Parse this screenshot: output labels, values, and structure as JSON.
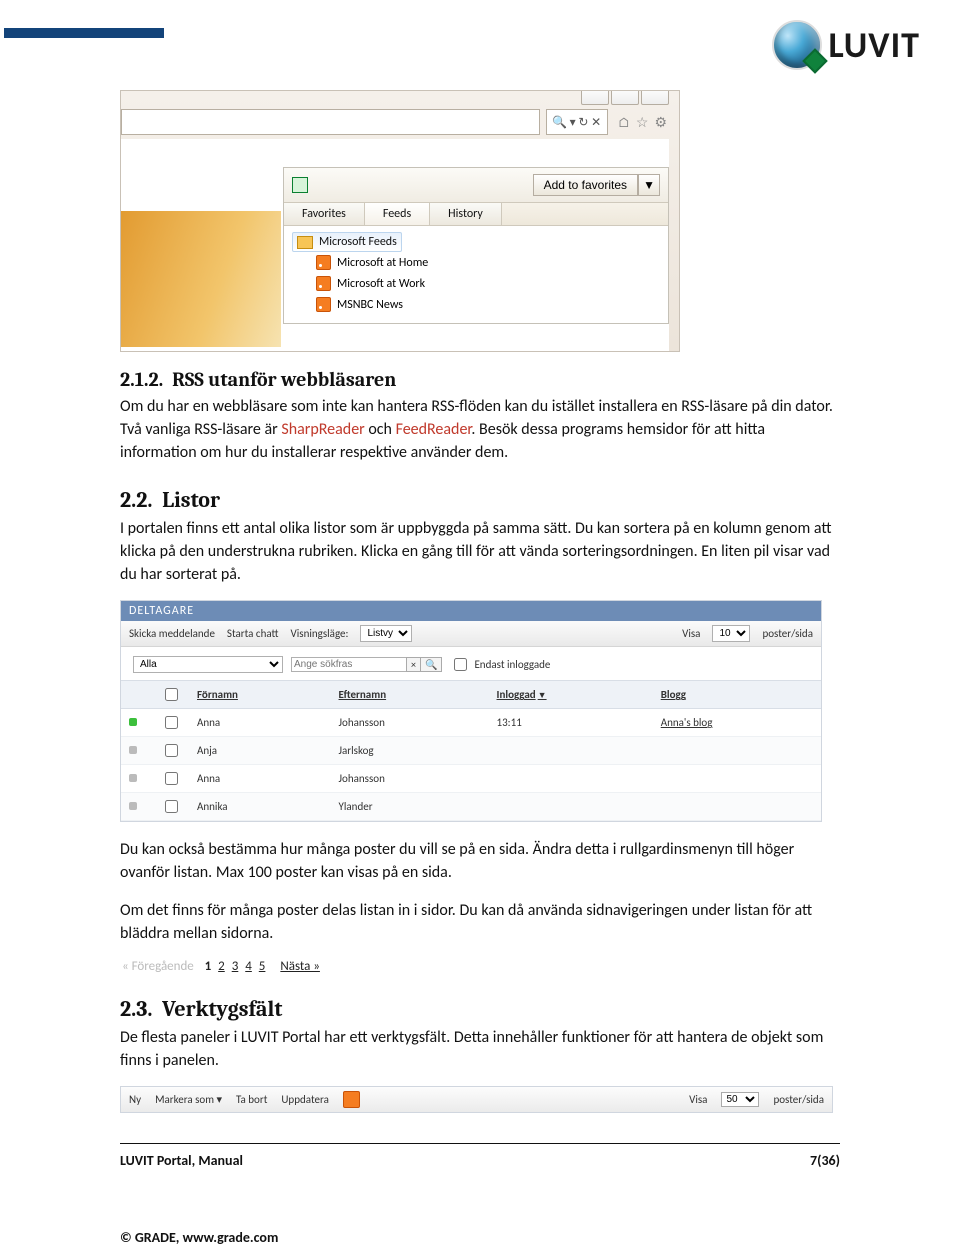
{
  "logo": {
    "text": "LUVIT"
  },
  "browser_shot": {
    "addr_icons": {
      "search": "🔍",
      "refresh": "↻",
      "stop": "✕",
      "home": "⌂",
      "star": "☆",
      "gear": "⚙"
    },
    "add_to_favorites": "Add to favorites",
    "tabs": [
      "Favorites",
      "Feeds",
      "History"
    ],
    "folder": "Microsoft Feeds",
    "feeds": [
      "Microsoft at Home",
      "Microsoft at Work",
      "MSNBC News"
    ]
  },
  "sec212": {
    "num": "2.1.2.",
    "title": "RSS utanför webbläsaren",
    "body_a": "Om du har en webbläsare som inte kan hantera RSS-flöden kan du istället installera en RSS-läsare på din dator. Två vanliga RSS-läsare är ",
    "link1": "SharpReader",
    "mid": " och ",
    "link2": "FeedReader",
    "body_b": ". Besök dessa programs hemsidor för att hitta information om hur du installerar respektive använder dem."
  },
  "sec22": {
    "num": "2.2.",
    "title": "Listor",
    "body": "I portalen finns ett antal olika listor som är uppbyggda på samma sätt. Du kan sortera på en kolumn genom att klicka på den understrukna rubriken. Klicka en gång till för att vända sorteringsordningen. En liten pil visar vad du har sorterat på."
  },
  "deltagare": {
    "panel_title": "DELTAGARE",
    "tools": {
      "send_msg": "Skicka meddelande",
      "start_chat": "Starta chatt",
      "view_label": "Visningsläge:",
      "view_value": "Listvy",
      "show_label": "Visa",
      "show_value": "10",
      "per_page": "poster/sida"
    },
    "filter": {
      "dropdown": "Alla",
      "search_placeholder": "Ange sökfras",
      "only_logged": "Endast inloggade"
    },
    "cols": {
      "first": "Förnamn",
      "last": "Efternamn",
      "logged": "Inloggad",
      "blog": "Blogg"
    },
    "rows": [
      {
        "status": "green",
        "first": "Anna",
        "last": "Johansson",
        "logged": "13:11",
        "blog": "Anna's blog"
      },
      {
        "status": "grey",
        "first": "Anja",
        "last": "Jarlskog",
        "logged": "",
        "blog": ""
      },
      {
        "status": "grey",
        "first": "Anna",
        "last": "Johansson",
        "logged": "",
        "blog": ""
      },
      {
        "status": "grey",
        "first": "Annika",
        "last": "Ylander",
        "logged": "",
        "blog": ""
      }
    ]
  },
  "para_after_list1": "Du kan också bestämma hur många poster du vill se på en sida. Ändra detta i rullgardinsmenyn till höger ovanför listan. Max 100 poster kan visas på en sida.",
  "para_after_list2": "Om det finns för många poster delas listan in i sidor. Du kan då använda sidnavigeringen under listan för att bläddra mellan sidorna.",
  "pager": {
    "prev": "« Föregående",
    "pages": [
      "1",
      "2",
      "3",
      "4",
      "5"
    ],
    "next": "Nästa »"
  },
  "sec23": {
    "num": "2.3.",
    "title": "Verktygsfält",
    "body": "De flesta paneler i LUVIT Portal har ett verktygsfält. Detta innehåller funktioner för att hantera de objekt som finns i panelen."
  },
  "toolbar": {
    "ny": "Ny",
    "mark": "Markera som",
    "del": "Ta bort",
    "upd": "Uppdatera",
    "show_label": "Visa",
    "show_value": "50",
    "per_page": "poster/sida"
  },
  "footer": {
    "left": "LUVIT Portal,  Manual",
    "right": "7(36)",
    "copyright": "© GRADE, www.grade.com"
  }
}
